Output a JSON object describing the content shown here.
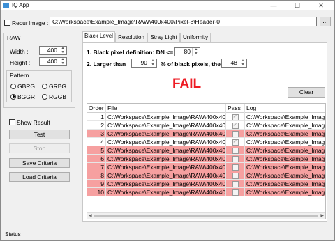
{
  "window": {
    "title": "IQ App",
    "minimize_glyph": "—",
    "maximize_glyph": "☐",
    "close_glyph": "✕",
    "icon": "app-icon"
  },
  "top": {
    "recur_label": "Recur",
    "recur_checked": false,
    "image_label": "Image :",
    "image_path": "C:\\Workspace\\Example_Image\\RAW\\400x400\\Pixel-8\\Header-0",
    "browse_label": "..."
  },
  "raw": {
    "group_label": "RAW",
    "width_label": "Width :",
    "width_value": "400",
    "height_label": "Height :",
    "height_value": "400",
    "pattern_label": "Pattern",
    "patterns": [
      {
        "label": "GBRG",
        "selected": false
      },
      {
        "label": "GRBG",
        "selected": false
      },
      {
        "label": "BGGR",
        "selected": true
      },
      {
        "label": "RGGB",
        "selected": false
      }
    ]
  },
  "left_actions": {
    "show_result_label": "Show Result",
    "show_result_checked": false,
    "test_label": "Test",
    "stop_label": "Stop",
    "save_label": "Save Criteria",
    "load_label": "Load Criteria"
  },
  "tabs": [
    {
      "label": "Black Level",
      "active": true
    },
    {
      "label": "Resolution",
      "active": false
    },
    {
      "label": "Stray Light",
      "active": false
    },
    {
      "label": "Uniformity",
      "active": false
    }
  ],
  "black_level": {
    "criteria1_label": "1. Black pixel definition: DN <=",
    "criteria1_value": "80",
    "criteria2_label_a": "2. Larger than",
    "criteria2_value_a": "90",
    "criteria2_label_b": "% of black pixels, their DNs <",
    "criteria2_value_b": "48",
    "result": "FAIL",
    "clear_label": "Clear"
  },
  "table": {
    "headers": {
      "order": "Order",
      "file": "File",
      "pass": "Pass",
      "log": "Log"
    },
    "rows": [
      {
        "order": "1",
        "file": "C:\\Workspace\\Example_Image\\RAW\\400x400\\",
        "pass": true,
        "log": "C:\\Workspace\\Example_Image\\RA",
        "fail": false
      },
      {
        "order": "2",
        "file": "C:\\Workspace\\Example_Image\\RAW\\400x400\\",
        "pass": true,
        "log": "C:\\Workspace\\Example_Image\\RA",
        "fail": false
      },
      {
        "order": "3",
        "file": "C:\\Workspace\\Example_Image\\RAW\\400x400\\",
        "pass": false,
        "log": "C:\\Workspace\\Example_Image\\RA",
        "fail": true
      },
      {
        "order": "4",
        "file": "C:\\Workspace\\Example_Image\\RAW\\400x400\\",
        "pass": true,
        "log": "C:\\Workspace\\Example_Image\\RA",
        "fail": false
      },
      {
        "order": "5",
        "file": "C:\\Workspace\\Example_Image\\RAW\\400x400\\",
        "pass": false,
        "log": "C:\\Workspace\\Example_Image\\RA",
        "fail": true
      },
      {
        "order": "6",
        "file": "C:\\Workspace\\Example_Image\\RAW\\400x400\\",
        "pass": false,
        "log": "C:\\Workspace\\Example_Image\\RA",
        "fail": true
      },
      {
        "order": "7",
        "file": "C:\\Workspace\\Example_Image\\RAW\\400x400\\",
        "pass": false,
        "log": "C:\\Workspace\\Example_Image\\RA",
        "fail": true
      },
      {
        "order": "8",
        "file": "C:\\Workspace\\Example_Image\\RAW\\400x400\\",
        "pass": false,
        "log": "C:\\Workspace\\Example_Image\\RA",
        "fail": true
      },
      {
        "order": "9",
        "file": "C:\\Workspace\\Example_Image\\RAW\\400x400\\",
        "pass": false,
        "log": "C:\\Workspace\\Example_Image\\RA",
        "fail": true
      },
      {
        "order": "10",
        "file": "C:\\Workspace\\Example_Image\\RAW\\400x400\\",
        "pass": false,
        "log": "C:\\Workspace\\Example_Image\\RA",
        "fail": true
      }
    ]
  },
  "status": {
    "label": "Status"
  },
  "colors": {
    "fail_text": "#ee1c24",
    "fail_row": "#f6a0a0"
  }
}
